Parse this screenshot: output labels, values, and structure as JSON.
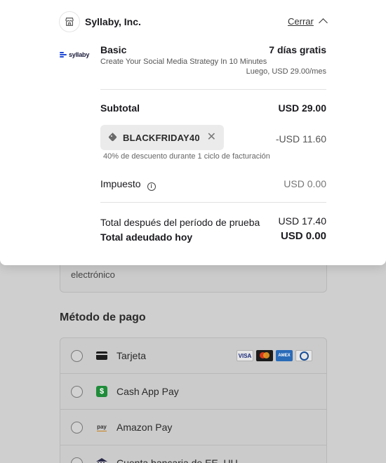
{
  "merchant": {
    "name": "Syllaby, Inc.",
    "close_label": "Cerrar"
  },
  "logo": {
    "text": "syllaby"
  },
  "plan": {
    "name": "Basic",
    "description": "Create Your Social Media Strategy In 10 Minutes",
    "trial": "7 días gratis",
    "then": "Luego, USD 29.00/mes"
  },
  "summary": {
    "subtotal_label": "Subtotal",
    "subtotal_value": "USD 29.00",
    "promo_code": "BLACKFRIDAY40",
    "promo_discount": "-USD 11.60",
    "promo_note": "40% de descuento durante 1 ciclo de facturación",
    "tax_label": "Impuesto",
    "tax_value": "USD 0.00",
    "after_trial_label": "Total después del período de prueba",
    "after_trial_value": "USD 17.40",
    "due_today_label": "Total adeudado hoy",
    "due_today_value": "USD 0.00"
  },
  "background": {
    "email_note_line": "electrónico",
    "payment_method_title": "Método de pago",
    "methods": [
      {
        "label": "Tarjeta",
        "icon": "card-icon"
      },
      {
        "label": "Cash App Pay",
        "icon": "cashapp-icon"
      },
      {
        "label": "Amazon Pay",
        "icon": "amazon-pay-icon"
      },
      {
        "label": "Cuenta bancaria de EE. UU.",
        "icon": "bank-icon"
      }
    ],
    "card_brands": [
      "VISA",
      "AMEX"
    ],
    "cashapp_glyph": "$",
    "amazon_glyph": "pay"
  }
}
